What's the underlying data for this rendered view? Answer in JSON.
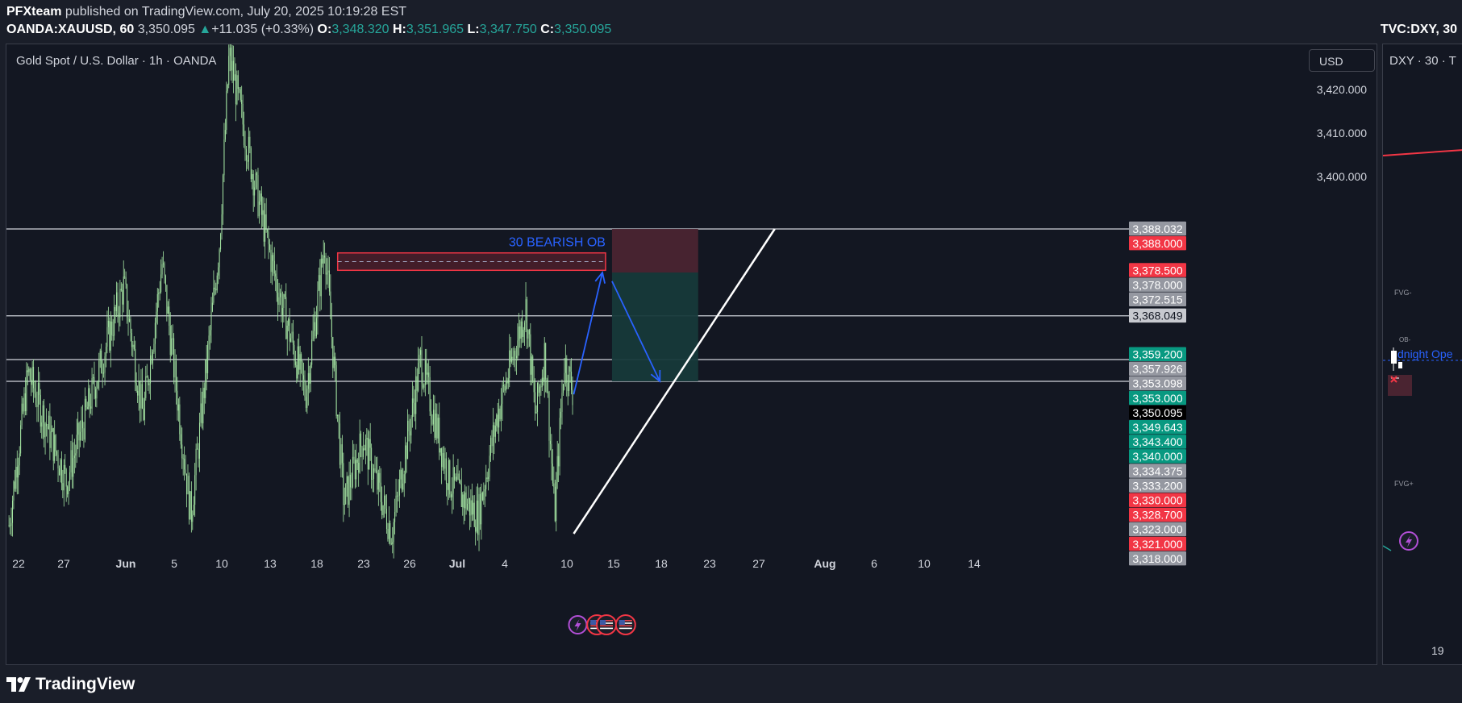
{
  "header": {
    "author": "PFXteam",
    "published": "published on TradingView.com, July 20, 2025 10:19:28 EST",
    "symbol": "OANDA:XAUUSD, 60",
    "last_price": "3,350.095",
    "change_arrow": "▲",
    "change": "+11.035 (+0.33%)",
    "open_label": "O:",
    "open": "3,348.320",
    "high_label": "H:",
    "high": "3,351.965",
    "low_label": "L:",
    "low": "3,347.750",
    "close_label": "C:",
    "close": "3,350.095",
    "right_symbol": "TVC:DXY, 30"
  },
  "main_chart": {
    "legend": "Gold Spot / U.S. Dollar · 1h · OANDA",
    "currency_button": "USD"
  },
  "side_chart": {
    "legend": "DXY · 30 · T",
    "labels": [
      "FVG-",
      "OB-",
      "dnight Ope",
      "FVG+"
    ],
    "x_tick": "19"
  },
  "footer": {
    "brand": "TradingView"
  },
  "colors": {
    "background": "#131722",
    "candle": "#a5e6a3",
    "bearish_ob": "#f23645",
    "arrow": "#2962ff",
    "trendline": "#ffffff",
    "stop_zone": "#4a2431",
    "target_zone": "#16393a",
    "green_label": "#089981",
    "red_label": "#f23645",
    "grey_label": "#9598a1"
  },
  "chart_data": {
    "type": "candlestick",
    "title": "Gold Spot / U.S. Dollar · 1h · OANDA",
    "ylim": [
      3318,
      3430
    ],
    "y_ticks": [
      "3,420.000",
      "3,410.000",
      "3,400.000"
    ],
    "x_ticks": [
      "22",
      "27",
      "Jun",
      "5",
      "10",
      "13",
      "18",
      "23",
      "26",
      "Jul",
      "4",
      "10",
      "15",
      "18",
      "23",
      "27",
      "Aug",
      "6",
      "10",
      "14"
    ],
    "price_path": [
      {
        "t": "May 21",
        "v": 3320
      },
      {
        "t": "May 23",
        "v": 3355
      },
      {
        "t": "May 27",
        "v": 3330
      },
      {
        "t": "Jun 2",
        "v": 3375
      },
      {
        "t": "Jun 4",
        "v": 3345
      },
      {
        "t": "Jun 6",
        "v": 3380
      },
      {
        "t": "Jun 9",
        "v": 3322
      },
      {
        "t": "Jun 12",
        "v": 3385
      },
      {
        "t": "Jun 13",
        "v": 3428
      },
      {
        "t": "Jun 16",
        "v": 3395
      },
      {
        "t": "Jun 18",
        "v": 3375
      },
      {
        "t": "Jun 21",
        "v": 3350
      },
      {
        "t": "Jun 23",
        "v": 3385
      },
      {
        "t": "Jun 25",
        "v": 3325
      },
      {
        "t": "Jun 27",
        "v": 3340
      },
      {
        "t": "Jun 30",
        "v": 3318
      },
      {
        "t": "Jul 3",
        "v": 3358
      },
      {
        "t": "Jul 6",
        "v": 3330
      },
      {
        "t": "Jul 9",
        "v": 3322
      },
      {
        "t": "Jul 11",
        "v": 3345
      },
      {
        "t": "Jul 14",
        "v": 3370
      },
      {
        "t": "Jul 15",
        "v": 3345
      },
      {
        "t": "Jul 16",
        "v": 3360
      },
      {
        "t": "Jul 17",
        "v": 3322
      },
      {
        "t": "Jul 18",
        "v": 3358
      },
      {
        "t": "Jul 19",
        "v": 3350
      }
    ],
    "horizontal_lines": [
      3388.0,
      3368.049,
      3358.0,
      3353.0
    ],
    "bearish_ob": {
      "label": "30 BEARISH OB",
      "low": 3378.5,
      "high": 3382.5,
      "from": "Jun 24",
      "to": "Jul 23"
    },
    "short_position": {
      "entry": 3378.0,
      "stop": 3388.0,
      "target": 3353.0,
      "from": "Jul 23",
      "to": "Aug 1"
    },
    "projection_arrows": [
      {
        "from_t": "Jul 19",
        "from_v": 3350,
        "to_t": "Jul 22",
        "to_v": 3378
      },
      {
        "from_t": "Jul 23",
        "from_v": 3376,
        "to_t": "Jul 28",
        "to_v": 3353
      }
    ],
    "trendline": {
      "from_t": "Jul 19",
      "from_v": 3318,
      "to_t": "Aug 9",
      "to_v": 3388
    },
    "price_labels": [
      {
        "text": "3,388.032",
        "kind": "grey",
        "v": 3388.032
      },
      {
        "text": "3,388.000",
        "kind": "red",
        "v": 3388.0
      },
      {
        "text": "3,378.500",
        "kind": "red",
        "v": 3378.5
      },
      {
        "text": "3,378.000",
        "kind": "grey",
        "v": 3378.0
      },
      {
        "text": "3,372.515",
        "kind": "grey",
        "v": 3372.515
      },
      {
        "text": "3,368.049",
        "kind": "light",
        "v": 3368.049
      },
      {
        "text": "3,359.200",
        "kind": "green",
        "v": 3359.2
      },
      {
        "text": "3,357.926",
        "kind": "grey",
        "v": 3357.926
      },
      {
        "text": "3,353.098",
        "kind": "grey",
        "v": 3353.098
      },
      {
        "text": "3,353.000",
        "kind": "green",
        "v": 3353.0
      },
      {
        "text": "3,350.095",
        "kind": "black",
        "v": 3350.095
      },
      {
        "text": "3,349.643",
        "kind": "green",
        "v": 3349.643
      },
      {
        "text": "3,343.400",
        "kind": "green",
        "v": 3343.4
      },
      {
        "text": "3,340.000",
        "kind": "green",
        "v": 3340.0
      },
      {
        "text": "3,334.375",
        "kind": "grey",
        "v": 3334.375
      },
      {
        "text": "3,333.200",
        "kind": "grey",
        "v": 3333.2
      },
      {
        "text": "3,330.000",
        "kind": "red",
        "v": 3330.0
      },
      {
        "text": "3,328.700",
        "kind": "red",
        "v": 3328.7
      },
      {
        "text": "3,323.000",
        "kind": "grey",
        "v": 3323.0
      },
      {
        "text": "3,321.000",
        "kind": "red",
        "v": 3321.0
      },
      {
        "text": "3,318.000",
        "kind": "grey",
        "v": 3318.0
      }
    ],
    "events": [
      {
        "icon": "lightning-icon",
        "t": "Jul 19"
      },
      {
        "icon": "us-flag-icon",
        "t": "Jul 21"
      },
      {
        "icon": "us-flag-icon",
        "t": "Jul 22"
      },
      {
        "icon": "us-flag-icon",
        "t": "Jul 24"
      }
    ]
  }
}
